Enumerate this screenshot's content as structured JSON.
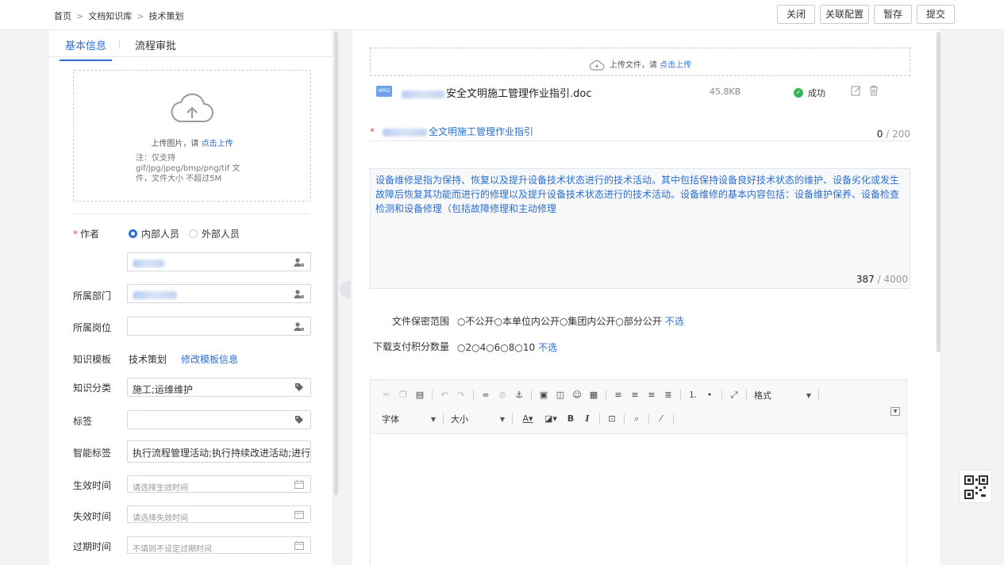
{
  "breadcrumb": [
    "首页",
    "文档知识库",
    "技术策划"
  ],
  "actions": {
    "close": "关闭",
    "link_config": "关联配置",
    "save_draft": "暂存",
    "submit": "提交"
  },
  "left": {
    "tabs": [
      "基本信息",
      "流程审批"
    ],
    "upload_image": {
      "hint": "上传图片，请 ",
      "link": "点击上传",
      "note": "注：仅支持 gif/jpg/jpeg/bmp/png/tif 文件，文件大小 不超过5M"
    },
    "author": {
      "label": "作者",
      "options": [
        "内部人员",
        "外部人员"
      ],
      "selected": "内部人员"
    },
    "department": {
      "label": "所属部门"
    },
    "position": {
      "label": "所属岗位"
    },
    "template": {
      "label": "知识模板",
      "value": "技术策划",
      "link": "修改模板信息"
    },
    "category": {
      "label": "知识分类",
      "value": "施工;运维维护"
    },
    "tags": {
      "label": "标签",
      "value": ""
    },
    "smart_tags": {
      "label": "智能标签",
      "value": "执行流程管理活动;执行持续改进活动;进行"
    },
    "effective": {
      "label": "生效时间",
      "placeholder": "请选择生效时间"
    },
    "expire": {
      "label": "失效时间",
      "placeholder": "请选择失效时间"
    },
    "overdue": {
      "label": "过期时间",
      "placeholder": "不填则不设定过期时间"
    }
  },
  "right": {
    "upload_file": {
      "hint": "上传文件，请 ",
      "link": "点击上传"
    },
    "file": {
      "name_suffix": "安全文明施工管理作业指引.doc",
      "size": "45.8KB",
      "status": "成功",
      "type_badge": "WRD"
    },
    "title": {
      "text_suffix": "全文明施工管理作业指引",
      "count": "0",
      "max": " / 200"
    },
    "description": {
      "text": "设备维修是指为保持、恢复以及提升设备技术状态进行的技术活动。其中包括保持设备良好技术状态的维护、设备劣化或发生故障后恢复其功能而进行的修理以及提升设备技术状态进行的技术活动。设备维修的基本内容包括：设备维护保养、设备检查检测和设备修理（包括故障修理和主动修理",
      "count": "387",
      "max": " / 4000"
    },
    "secrecy": {
      "label": "文件保密范围",
      "options": "○不公开○本单位内公开○集团内公开○部分公开",
      "clear": "不选"
    },
    "points": {
      "label": "下载支付积分数量",
      "options": "○2○4○6○8○10",
      "clear": "不选"
    },
    "toolbar": {
      "format": "格式",
      "font": "字体",
      "size": "大小"
    }
  },
  "colors": {
    "accent": "#2c6fd1",
    "success": "#3cb45a",
    "required": "#e34d4d"
  }
}
